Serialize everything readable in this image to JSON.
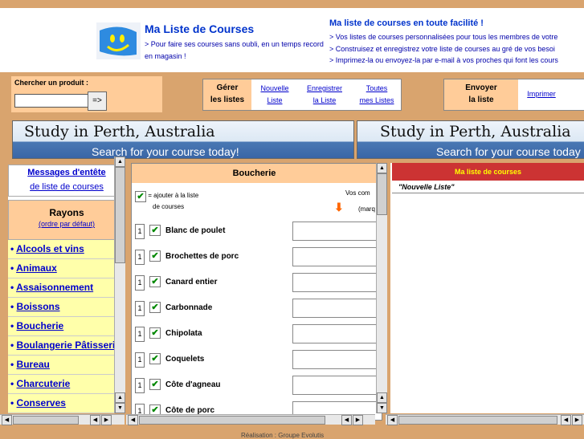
{
  "brand": {
    "title": "Ma Liste de Courses",
    "subtitle": "> Pour faire ses courses sans oubli, en un temps record en magasin !"
  },
  "promo": {
    "title": "Ma liste de courses en toute facilité !",
    "lines": [
      "> Vos listes de courses personnalisées pour tous les membres de votre",
      "> Construisez et enregistrez votre liste de courses au gré de vos besoi",
      "> Imprimez-la ou envoyez-la par e-mail à vos proches qui font les cours"
    ]
  },
  "search": {
    "label": "Chercher un produit :",
    "value": "",
    "button": "=>"
  },
  "manage": {
    "label_line1": "Gérer",
    "label_line2": "les listes",
    "links": [
      {
        "l1": "Nouvelle",
        "l2": "Liste"
      },
      {
        "l1": "Enregistrer",
        "l2": "la Liste"
      },
      {
        "l1": "Toutes",
        "l2": "mes Listes"
      }
    ]
  },
  "send": {
    "label_line1": "Envoyer",
    "label_line2": "la liste",
    "print_link": "Imprimer"
  },
  "banners": [
    {
      "title": "Study in Perth, Australia",
      "cta": "Search for your course today!"
    },
    {
      "title": "Study in Perth, Australia",
      "cta": "Search for your course today"
    }
  ],
  "sidebar": {
    "messages_line1": "Messages d'entête",
    "messages_line2": "de liste de courses",
    "rayons_title": "Rayons",
    "rayons_sub": "(ordre par défaut)",
    "categories": [
      "Alcools et vins",
      "Animaux",
      "Assaisonnement",
      "Boissons",
      "Boucherie",
      "Boulangerie Pâtisserie",
      "Bureau",
      "Charcuterie",
      "Conserves"
    ]
  },
  "center": {
    "title": "Boucherie",
    "legend_line1": "= ajouter à la liste",
    "legend_line2": "de courses",
    "vos": "Vos com",
    "marq": "(marq",
    "products": [
      {
        "qty": "1",
        "name": "Blanc de poulet"
      },
      {
        "qty": "1",
        "name": "Brochettes de porc"
      },
      {
        "qty": "1",
        "name": "Canard entier"
      },
      {
        "qty": "1",
        "name": "Carbonnade"
      },
      {
        "qty": "1",
        "name": "Chipolata"
      },
      {
        "qty": "1",
        "name": "Coquelets"
      },
      {
        "qty": "1",
        "name": "Côte d'agneau"
      },
      {
        "qty": "1",
        "name": "Côte de porc"
      }
    ]
  },
  "right": {
    "title": "Ma liste de courses",
    "list_name": "\"Nouvelle Liste\""
  },
  "footer": {
    "text": "Réalisation : Groupe Evolutis"
  },
  "colors": {
    "background": "#d9a46e",
    "panel_header": "#ffcc99",
    "category_bg": "#ffffaa",
    "list_header": "#cc3333",
    "link": "#0000cc"
  }
}
